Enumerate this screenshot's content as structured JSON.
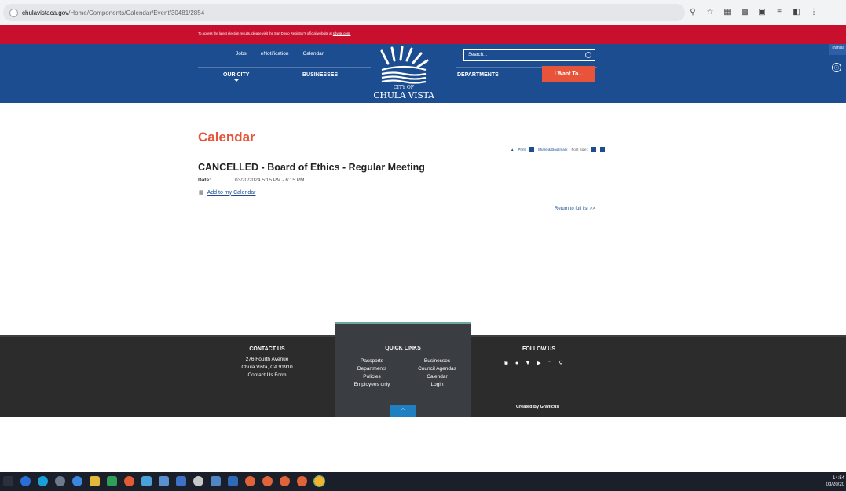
{
  "browser": {
    "url_host": "chulavistaca.gov",
    "url_path": "/Home/Components/Calendar/Event/30481/2854"
  },
  "alert": {
    "text": "To access the latest election results, please visit the San Diego Registrar's official website at ",
    "link": "sdvote.com."
  },
  "header": {
    "top_links": [
      "Jobs",
      "eNotification",
      "Calendar"
    ],
    "nav_our_city": "OUR CITY",
    "nav_businesses": "BUSINESSES",
    "nav_departments": "DEPARTMENTS",
    "search_placeholder": "Search...",
    "i_want": "I Want To...",
    "logo_line1": "CITY OF",
    "logo_line2": "CHULA VISTA",
    "translate": "Transla"
  },
  "main": {
    "title": "Calendar",
    "tools": {
      "print": "Print",
      "share": "Share & Bookmark",
      "font_size": "Font Size:"
    },
    "event_title": "CANCELLED - Board of Ethics - Regular Meeting",
    "date_label": "Date:",
    "date_value": "03/20/2024 5:15 PM - 6:15 PM",
    "add_to_calendar": "Add to my Calendar",
    "return_link": "Return to full list >>"
  },
  "footer": {
    "contact_title": "CONTACT US",
    "contact_lines": [
      "276 Fourth Avenue",
      "Chula Vista, CA 91910",
      "Contact Us Form"
    ],
    "quick_links_title": "QUICK LINKS",
    "quick_links": [
      "Passports",
      "Businesses",
      "Departments",
      "Council Agendas",
      "Policies",
      "Calendar",
      "Employees only",
      "Login"
    ],
    "follow_title": "FOLLOW US",
    "created_by": "Created By Granicus"
  },
  "taskbar": {
    "time": "14:54",
    "date": "03/20/20"
  },
  "colors": {
    "alert_red": "#c8102e",
    "header_blue": "#1c4d91",
    "accent_orange": "#e8543a",
    "footer_dark": "#2c2c2c"
  }
}
